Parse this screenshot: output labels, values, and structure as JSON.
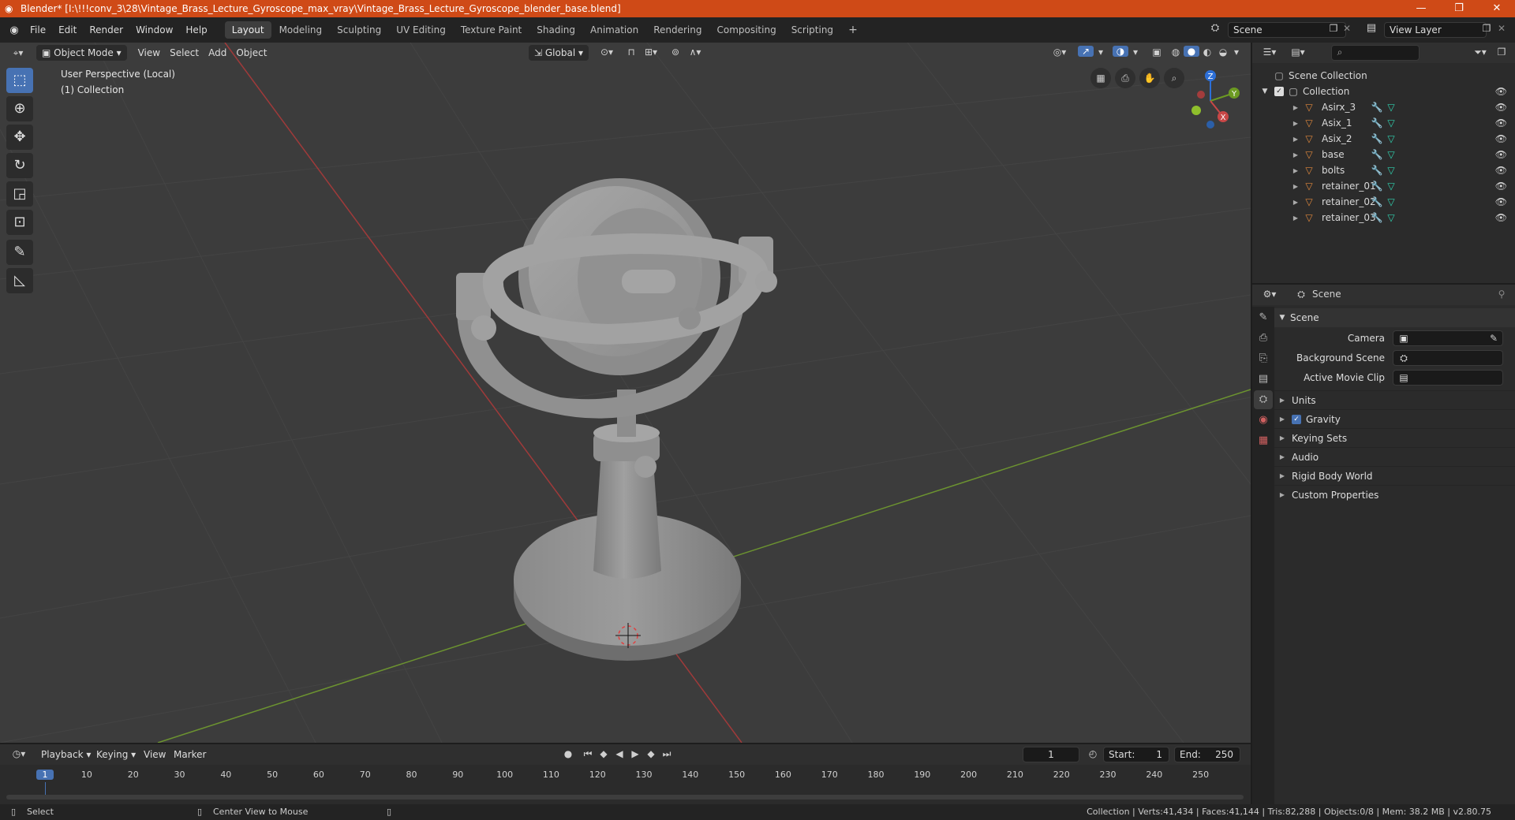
{
  "window": {
    "title": "Blender* [I:\\!!!conv_3\\28\\Vintage_Brass_Lecture_Gyroscope_max_vray\\Vintage_Brass_Lecture_Gyroscope_blender_base.blend]",
    "minimize": "—",
    "maximize": "❐",
    "close": "✕"
  },
  "menu": [
    "File",
    "Edit",
    "Render",
    "Window",
    "Help"
  ],
  "workspaces": [
    {
      "label": "Layout",
      "active": true
    },
    {
      "label": "Modeling"
    },
    {
      "label": "Sculpting"
    },
    {
      "label": "UV Editing"
    },
    {
      "label": "Texture Paint"
    },
    {
      "label": "Shading"
    },
    {
      "label": "Animation"
    },
    {
      "label": "Rendering"
    },
    {
      "label": "Compositing"
    },
    {
      "label": "Scripting"
    }
  ],
  "add_workspace": "+",
  "scene_field": "Scene",
  "view_layer_field": "View Layer",
  "viewport_header": {
    "mode": "Object Mode",
    "menus": [
      "View",
      "Select",
      "Add",
      "Object"
    ],
    "transform": "Global"
  },
  "viewport": {
    "perspective": "User Perspective (Local)",
    "collection": "(1) Collection",
    "gizmo": {
      "x": "X",
      "y": "Y",
      "z": "Z"
    }
  },
  "outliner": {
    "search_placeholder": "",
    "scene_collection": "Scene Collection",
    "collection": "Collection",
    "objects": [
      "Asirx_3",
      "Asix_1",
      "Asix_2",
      "base",
      "bolts",
      "retainer_01",
      "retainer_02",
      "retainer_03"
    ]
  },
  "properties": {
    "header": "Scene",
    "panel": "Scene",
    "fields": [
      {
        "label": "Camera"
      },
      {
        "label": "Background Scene"
      },
      {
        "label": "Active Movie Clip"
      }
    ],
    "sections": [
      {
        "label": "Units",
        "checkbox": false
      },
      {
        "label": "Gravity",
        "checkbox": true
      },
      {
        "label": "Keying Sets",
        "checkbox": false
      },
      {
        "label": "Audio",
        "checkbox": false
      },
      {
        "label": "Rigid Body World",
        "checkbox": false
      },
      {
        "label": "Custom Properties",
        "checkbox": false
      }
    ]
  },
  "timeline": {
    "menus": [
      "Playback",
      "Keying",
      "View",
      "Marker"
    ],
    "current_frame": "1",
    "start_label": "Start:",
    "start": "1",
    "end_label": "End:",
    "end": "250",
    "ruler": [
      "1",
      "10",
      "20",
      "30",
      "40",
      "50",
      "60",
      "70",
      "80",
      "90",
      "100",
      "110",
      "120",
      "130",
      "140",
      "150",
      "160",
      "170",
      "180",
      "190",
      "200",
      "210",
      "220",
      "230",
      "240",
      "250"
    ]
  },
  "status": {
    "left_action": "Select",
    "mid_action": "Center View to Mouse",
    "stats": "Collection | Verts:41,434 | Faces:41,144 | Tris:82,288 | Objects:0/8 | Mem: 38.2 MB | v2.80.75"
  },
  "colors": {
    "titlebar": "#cf4a17",
    "accent": "#4772b3",
    "viewport_bg": "#3c3c3c",
    "x_axis": "#b0403f",
    "y_axis": "#7aa32b",
    "mesh_icon": "#2fd3b0",
    "object_icon": "#e0883c"
  }
}
